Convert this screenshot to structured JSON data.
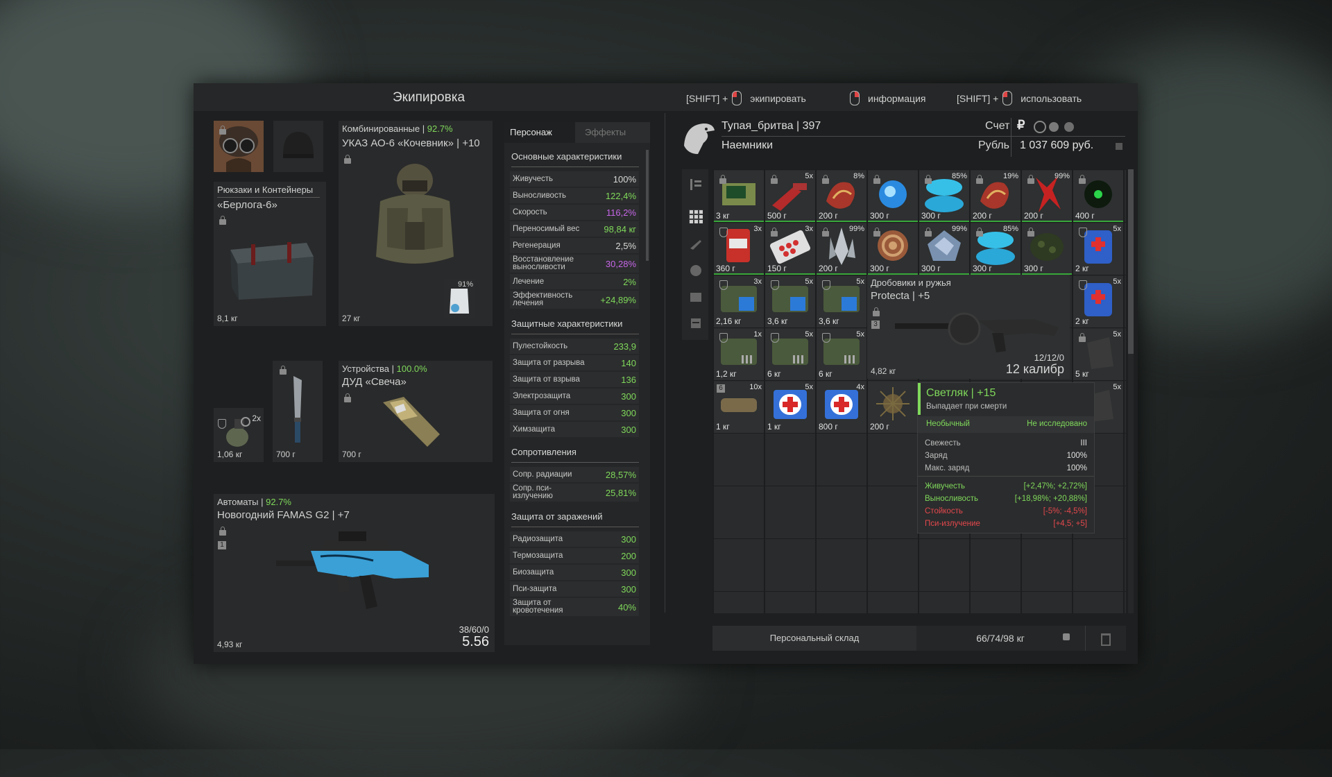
{
  "header": {
    "title": "Экипировка",
    "hint1_prefix": "[SHIFT] +",
    "hint1_label": "экипировать",
    "hint2_label": "информация",
    "hint3_prefix": "[SHIFT] +",
    "hint3_label": "использовать"
  },
  "equipment": {
    "backpack": {
      "category": "Рюкзаки и Контейнеры",
      "name": "«Берлога-6»",
      "weight": "8,1 кг"
    },
    "armor": {
      "category": "Комбинированные | ",
      "durability": "92.7%",
      "name": "УКАЗ АО-6 «Кочевник» | +10",
      "weight": "27 кг",
      "sub_durability": "91%"
    },
    "grenade": {
      "count": "2x",
      "weight": "1,06 кг"
    },
    "knife": {
      "weight": "700 г"
    },
    "device": {
      "category": "Устройства | ",
      "durability": "100.0%",
      "name": "ДУД «Свеча»",
      "weight": "700 г"
    },
    "rifle": {
      "category": "Автоматы | ",
      "durability": "92.7%",
      "name": "Новогодний FAMAS G2 | +7",
      "weight": "4,93 кг",
      "ammo": "38/60/0",
      "caliber": "5.56",
      "slot_number": "1"
    }
  },
  "stats": {
    "tab_character": "Персонаж",
    "tab_effects": "Эффекты",
    "basic_title": "Основные характеристики",
    "basic": [
      {
        "name": "Живучесть",
        "value": "100%",
        "color": "#d8d8d8"
      },
      {
        "name": "Выносливость",
        "value": "122,4%",
        "color": "#7fd95b"
      },
      {
        "name": "Скорость",
        "value": "116,2%",
        "color": "#c667e8"
      },
      {
        "name": "Переносимый вес",
        "value": "98,84 кг",
        "color": "#7fd95b"
      },
      {
        "name": "Регенерация",
        "value": "2,5%",
        "color": "#d8d8d8"
      },
      {
        "name": "Восстановление выносливости",
        "value": "30,28%",
        "color": "#c667e8"
      },
      {
        "name": "Лечение",
        "value": "2%",
        "color": "#7fd95b"
      },
      {
        "name": "Эффективность лечения",
        "value": "+24,89%",
        "color": "#7fd95b"
      }
    ],
    "defense_title": "Защитные характеристики",
    "defense": [
      {
        "name": "Пулестойкость",
        "value": "233,9"
      },
      {
        "name": "Защита от разрыва",
        "value": "140"
      },
      {
        "name": "Защита от взрыва",
        "value": "136"
      },
      {
        "name": "Электрозащита",
        "value": "300"
      },
      {
        "name": "Защита от огня",
        "value": "300"
      },
      {
        "name": "Химзащита",
        "value": "300"
      }
    ],
    "resist_title": "Сопротивления",
    "resist": [
      {
        "name": "Сопр. радиации",
        "value": "28,57%"
      },
      {
        "name": "Сопр. пси-излучению",
        "value": "25,81%"
      }
    ],
    "contam_title": "Защита от заражений",
    "contam": [
      {
        "name": "Радиозащита",
        "value": "300"
      },
      {
        "name": "Термозащита",
        "value": "200"
      },
      {
        "name": "Биозащита",
        "value": "300"
      },
      {
        "name": "Пси-защита",
        "value": "300"
      },
      {
        "name": "Защита от кровотечения",
        "value": "40%"
      }
    ]
  },
  "player": {
    "name": "Тупая_бритва | 397",
    "faction": "Наемники",
    "account_label": "Счет",
    "currency_label": "Рубль",
    "balance": "1 037 609 руб."
  },
  "inventory": {
    "items": [
      {
        "w": "3 кг",
        "q": "",
        "kind": "device",
        "green": true
      },
      {
        "w": "500 г",
        "q": "5x",
        "kind": "red-plant",
        "green": true
      },
      {
        "w": "200 г",
        "q": "8%",
        "kind": "red-art",
        "green": true
      },
      {
        "w": "300 г",
        "q": "",
        "kind": "blue-orb",
        "green": true
      },
      {
        "w": "300 г",
        "q": "85%",
        "kind": "cyan-art",
        "green": true
      },
      {
        "w": "200 г",
        "q": "19%",
        "kind": "red-art",
        "green": true
      },
      {
        "w": "200 г",
        "q": "99%",
        "kind": "red-spike",
        "green": true
      },
      {
        "w": "400 г",
        "q": "",
        "kind": "dark-green",
        "green": true
      },
      {
        "w": "360 г",
        "q": "3x",
        "kind": "jar",
        "green": true
      },
      {
        "w": "150 г",
        "q": "3x",
        "kind": "pills",
        "green": true
      },
      {
        "w": "200 г",
        "q": "99%",
        "kind": "crystal",
        "green": true
      },
      {
        "w": "300 г",
        "q": "",
        "kind": "spiral",
        "green": true
      },
      {
        "w": "300 г",
        "q": "99%",
        "kind": "ice",
        "green": true
      },
      {
        "w": "300 г",
        "q": "85%",
        "kind": "cyan-art",
        "green": true
      },
      {
        "w": "300 г",
        "q": "",
        "kind": "moss",
        "green": true
      },
      {
        "w": "2 кг",
        "q": "5x",
        "kind": "medkit-blue",
        "green": false
      },
      {
        "w": "2,16 кг",
        "q": "3x",
        "kind": "ammo-blue",
        "green": false
      },
      {
        "w": "3,6 кг",
        "q": "5x",
        "kind": "ammo-blue",
        "green": false
      },
      {
        "w": "3,6 кг",
        "q": "5x",
        "kind": "ammo-blue",
        "green": false
      },
      {
        "w": "2 кг",
        "q": "5x",
        "kind": "medkit-blue",
        "green": false
      },
      {
        "w": "1,2 кг",
        "q": "1x",
        "kind": "ammo-grey",
        "green": false
      },
      {
        "w": "6 кг",
        "q": "5x",
        "kind": "ammo-grey",
        "green": false
      },
      {
        "w": "6 кг",
        "q": "5x",
        "kind": "ammo-grey",
        "green": false
      },
      {
        "w": "5 кг",
        "q": "5x",
        "kind": "dark",
        "green": false
      },
      {
        "w": "1 кг",
        "q": "10x",
        "kind": "bandage",
        "green": false
      },
      {
        "w": "1 кг",
        "q": "5x",
        "kind": "medkit",
        "green": false
      },
      {
        "w": "800 г",
        "q": "4x",
        "kind": "medkit",
        "green": false
      },
      {
        "w": "200 г",
        "q": "",
        "kind": "spiky",
        "green": false
      },
      {
        "w": "",
        "q": "5x",
        "kind": "dark",
        "green": false
      }
    ],
    "shotgun": {
      "category": "Дробовики и ружья",
      "name": "Protecta | +5",
      "weight": "4,82 кг",
      "ammo": "12/12/0",
      "caliber": "12 калибр",
      "slot_number": "3"
    },
    "bandage_slot_number": "6"
  },
  "tooltip": {
    "title": "Светляк | +15",
    "subtitle": "Выпадает при смерти",
    "rarity": "Необычный",
    "research": "Не исследовано",
    "props": [
      {
        "name": "Свежесть",
        "value": "III"
      },
      {
        "name": "Заряд",
        "value": "100%"
      },
      {
        "name": "Макс. заряд",
        "value": "100%"
      }
    ],
    "effects": [
      {
        "name": "Живучесть",
        "value": "[+2,47%; +2,72%]",
        "color": "#7fd95b"
      },
      {
        "name": "Выносливость",
        "value": "[+18,98%; +20,88%]",
        "color": "#7fd95b"
      },
      {
        "name": "Стойкость",
        "value": "[-5%; -4,5%]",
        "color": "#e5484d"
      },
      {
        "name": "Пси-излучение",
        "value": "[+4,5; +5]",
        "color": "#e5484d"
      }
    ]
  },
  "footer": {
    "storage": "Персональный склад",
    "weight": "66/74/98 кг"
  }
}
